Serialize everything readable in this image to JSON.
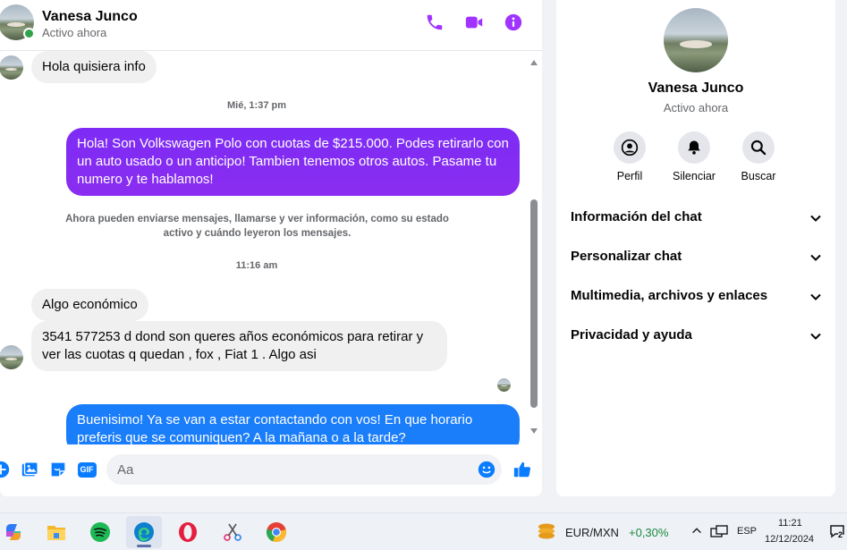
{
  "contact": {
    "name": "Vanesa Junco",
    "status": "Activo ahora"
  },
  "messages": {
    "first_incoming": "Hola quisiera info",
    "ts1": "Mié, 1:37 pm",
    "outgoing1": "Hola! Son Volkswagen Polo con cuotas de $215.000. Podes retirarlo con un auto usado o un anticipo! Tambien tenemos otros autos. Pasame tu numero y te hablamos!",
    "notice": "Ahora pueden enviarse mensajes, llamarse y ver información, como su estado activo y cuándo leyeron los mensajes.",
    "ts2": "11:16 am",
    "incoming2": "Algo económico",
    "incoming3": "3541 577253  d dond son queres años económicos para retirar y ver las cuotas q quedan , fox , Fiat 1 . Algo asi",
    "outgoing2": "Buenisimo! Ya se van a estar contactando con vos! En que horario preferis que se comuniquen? A la mañana o a la tarde?"
  },
  "composer": {
    "placeholder": "Aa",
    "gif_label": "GIF"
  },
  "info_panel": {
    "actions": [
      {
        "label": "Perfil",
        "icon": "profile-icon"
      },
      {
        "label": "Silenciar",
        "icon": "bell-icon"
      },
      {
        "label": "Buscar",
        "icon": "search-icon"
      }
    ],
    "sections": [
      "Información del chat",
      "Personalizar chat",
      "Multimedia, archivos y enlaces",
      "Privacidad y ayuda"
    ]
  },
  "taskbar": {
    "ticker_label": "EUR/MXN",
    "ticker_change": "+0,30%",
    "language": "ESP",
    "time": "11:21",
    "date": "12/12/2024",
    "notification_count": "2"
  },
  "colors": {
    "messenger_purple": "#a033ff",
    "outgoing_purple": "#8a2df0",
    "outgoing_blue": "#1a7dfa",
    "online_green": "#31a24c"
  }
}
